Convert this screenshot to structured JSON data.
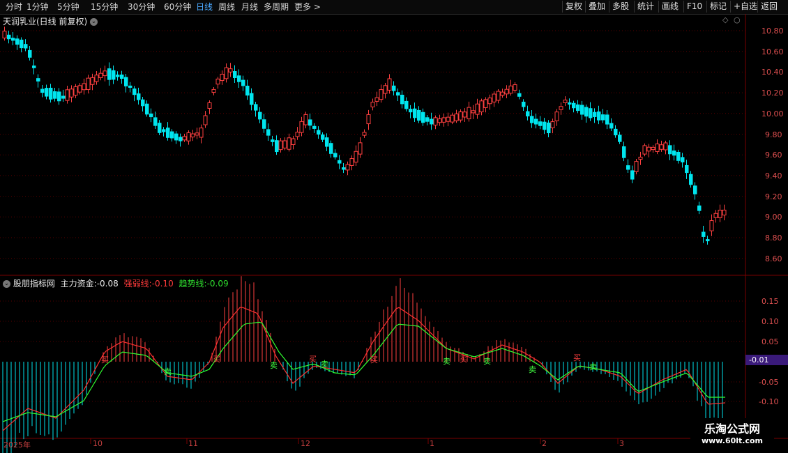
{
  "toolbar": {
    "left_items": [
      "分时",
      "1分钟",
      "5分钟",
      "15分钟",
      "30分钟",
      "60分钟",
      "日线",
      "周线",
      "月线",
      "多周期",
      "更多 >"
    ],
    "active": "日线",
    "right_items": [
      "复权",
      "叠加",
      "多股",
      "统计",
      "画线",
      "F10",
      "标记",
      "+自选",
      "返回"
    ]
  },
  "main_chart": {
    "title": "天润乳业(日线 前复权)",
    "y_ticks": [
      "10.80",
      "10.60",
      "10.40",
      "10.20",
      "10.00",
      "9.80",
      "9.60",
      "9.40",
      "9.20",
      "9.00",
      "8.80",
      "8.60"
    ]
  },
  "indicator": {
    "name": "股朋指标网",
    "fields": [
      {
        "label": "主力资金:",
        "value": "-0.08",
        "color": "#e8e8e8"
      },
      {
        "label": "强弱线:",
        "value": "-0.10",
        "color": "#ff3b3b"
      },
      {
        "label": "趋势线:",
        "value": "-0.09",
        "color": "#2fe02f"
      }
    ],
    "y_ticks": [
      "0.15",
      "0.10",
      "0.05",
      "-0.05",
      "-0.10"
    ],
    "current_badge": "-0.01",
    "signal_buy": "买",
    "signal_sell": "卖"
  },
  "x_axis": [
    "2025年",
    "10",
    "11",
    "12",
    "1",
    "2",
    "3"
  ],
  "watermark": {
    "line1": "乐淘公式网",
    "line2": "www.60lt.com"
  },
  "colors": {
    "up": "#ff4040",
    "down": "#00e5ee",
    "ma_red": "#ff3030",
    "ma_green": "#30ff30",
    "grid": "#3a0000"
  }
}
